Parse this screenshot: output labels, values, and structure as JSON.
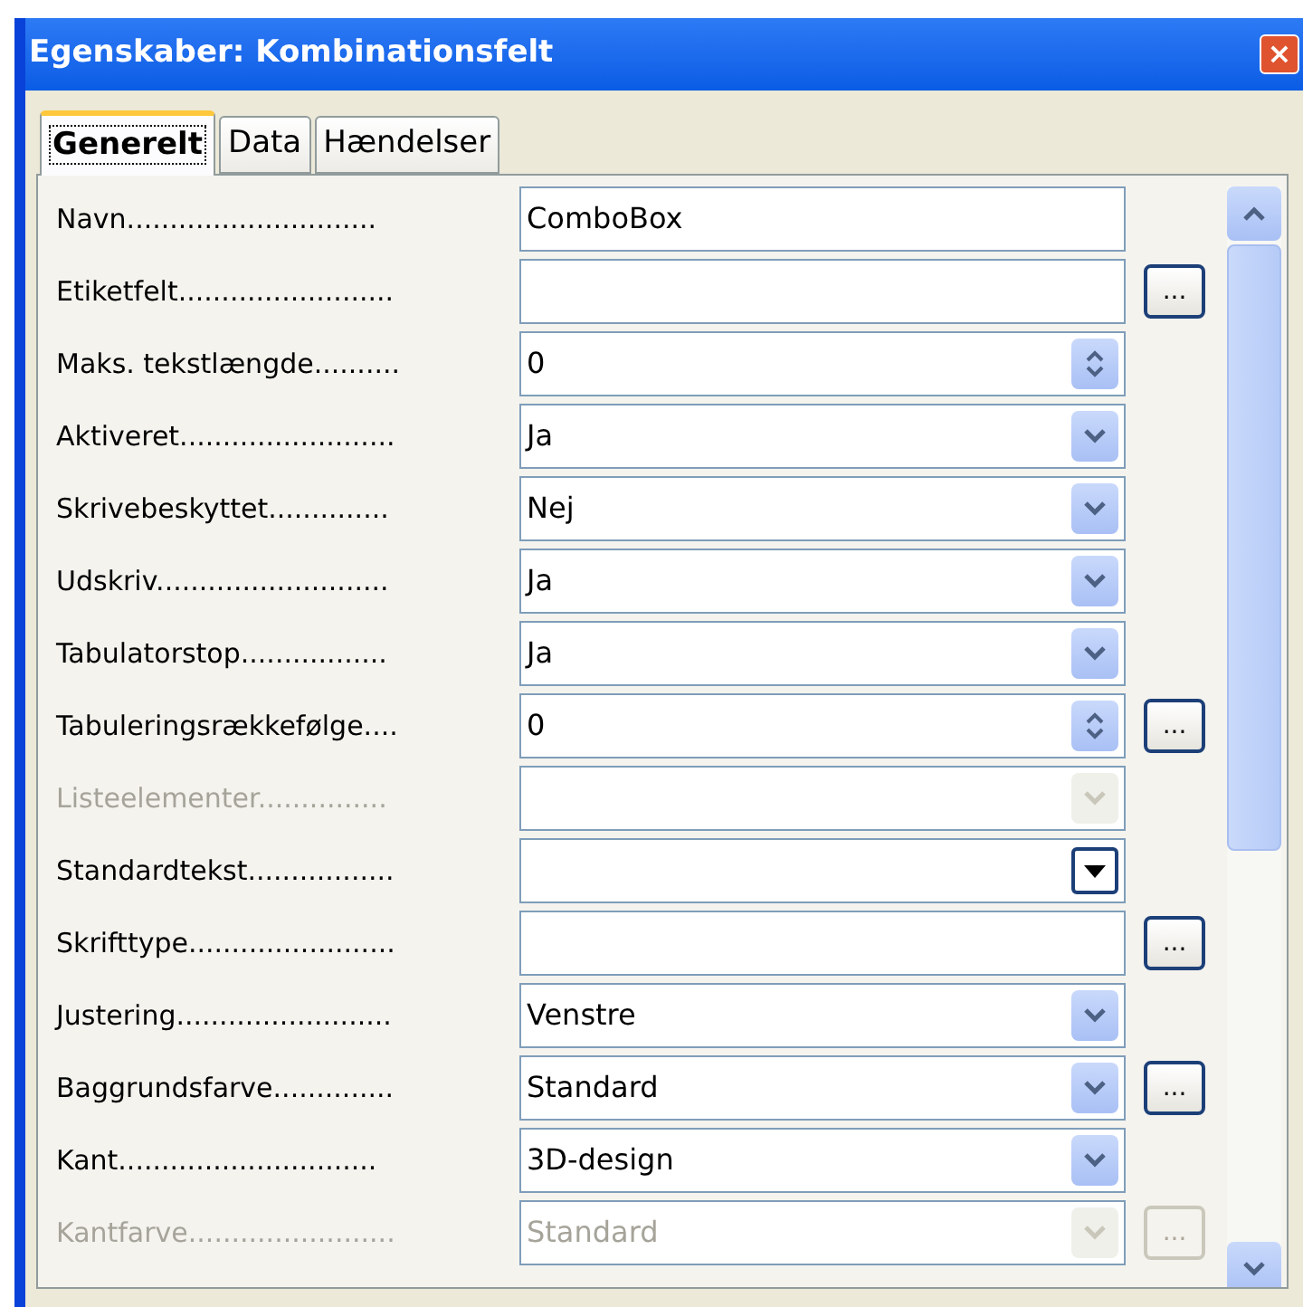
{
  "window": {
    "title": "Egenskaber: Kombinationsfelt",
    "close": "×"
  },
  "tabs": [
    {
      "label": "Generelt",
      "selected": true
    },
    {
      "label": "Data",
      "selected": false
    },
    {
      "label": "Hændelser",
      "selected": false
    }
  ],
  "properties": [
    {
      "label": "Navn.............................",
      "kind": "text",
      "value": "ComboBox",
      "disabled": false
    },
    {
      "label": "Etiketfelt.........................",
      "kind": "text",
      "disabled": false,
      "button_label": "...",
      "button_disabled": false
    },
    {
      "label": "Maks. tekstlængde..........",
      "kind": "spin",
      "value": "0",
      "disabled": false
    },
    {
      "label": "Aktiveret.........................",
      "kind": "dropdown",
      "value": "Ja",
      "disabled": false
    },
    {
      "label": "Skrivebeskyttet..............",
      "kind": "dropdown",
      "value": "Nej",
      "disabled": false
    },
    {
      "label": "Udskriv...........................",
      "kind": "dropdown",
      "value": "Ja",
      "disabled": false
    },
    {
      "label": "Tabulatorstop.................",
      "kind": "dropdown",
      "value": "Ja",
      "disabled": false
    },
    {
      "label": "Tabuleringsrækkefølge....",
      "kind": "spin",
      "value": "0",
      "disabled": false,
      "button_label": "...",
      "button_disabled": false
    },
    {
      "label": "Listeelementer...............",
      "kind": "dropdown",
      "disabled": true
    },
    {
      "label": "Standardtekst.................",
      "kind": "combo",
      "disabled": false
    },
    {
      "label": "Skrifttype........................",
      "kind": "text",
      "disabled": false,
      "button_label": "...",
      "button_disabled": false
    },
    {
      "label": "Justering.........................",
      "kind": "dropdown",
      "value": "Venstre",
      "disabled": false
    },
    {
      "label": "Baggrundsfarve..............",
      "kind": "dropdown",
      "value": "Standard",
      "disabled": false,
      "button_label": "...",
      "button_disabled": false
    },
    {
      "label": "Kant..............................",
      "kind": "dropdown",
      "value": "3D-design",
      "disabled": false
    },
    {
      "label": "Kantfarve........................",
      "kind": "dropdown",
      "value": "Standard",
      "disabled": true,
      "button_label": "...",
      "button_disabled": true
    }
  ]
}
